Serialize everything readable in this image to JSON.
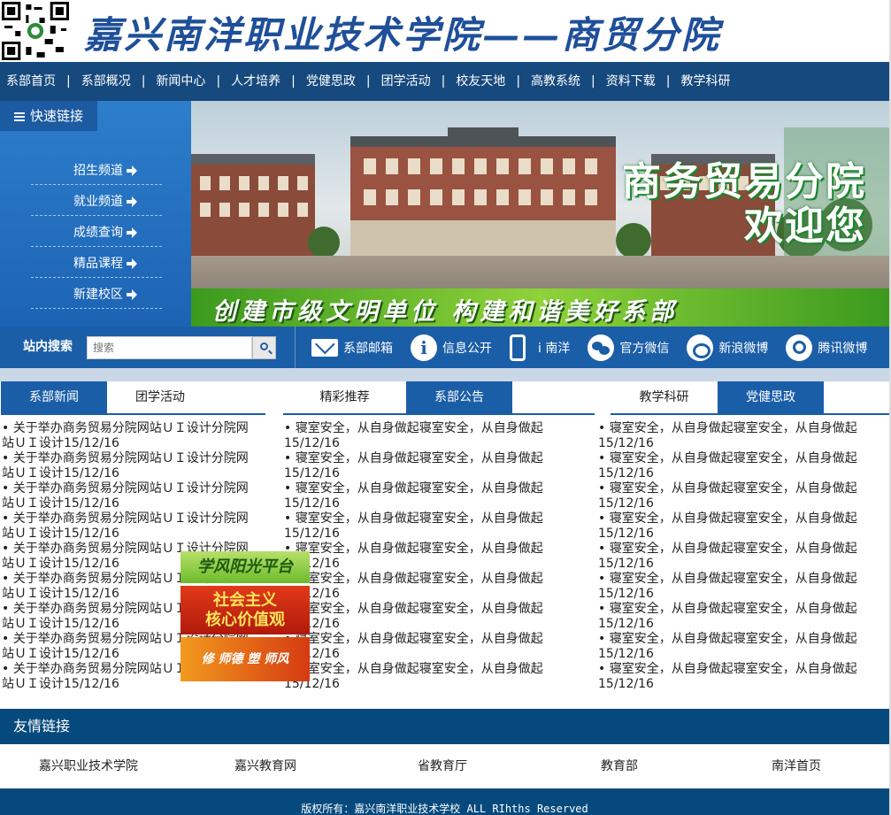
{
  "header": {
    "title": "嘉兴南洋职业技术学院——商贸分院"
  },
  "nav": {
    "items": [
      "系部首页",
      "系部概况",
      "新闻中心",
      "人才培养",
      "党健思政",
      "团学活动",
      "校友天地",
      "高教系统",
      "资料下载",
      "教学科研"
    ],
    "separator": "|"
  },
  "sidebar": {
    "title": "快速链接",
    "items": [
      {
        "label": "招生频道"
      },
      {
        "label": "就业频道"
      },
      {
        "label": "成绩查询"
      },
      {
        "label": "精品课程"
      },
      {
        "label": "新建校区"
      }
    ]
  },
  "banner": {
    "line1": "商务贸易分院",
    "line2": "欢迎您",
    "slogan": "创建市级文明单位 构建和谐美好系部"
  },
  "search": {
    "label": "站内搜索",
    "placeholder": "搜索"
  },
  "social": {
    "items": [
      {
        "label": "系部邮箱"
      },
      {
        "label": "信息公开"
      },
      {
        "label": "i 南洋"
      },
      {
        "label": "官方微信"
      },
      {
        "label": "新浪微博"
      },
      {
        "label": "腾讯微博"
      }
    ],
    "info_glyph": "i"
  },
  "tabs": {
    "group1": [
      "系部新闻",
      "团学活动"
    ],
    "group2": [
      "精彩推荐",
      "系部公告"
    ],
    "group3": [
      "教学科研",
      "党健思政"
    ]
  },
  "columns": {
    "bullet": "•",
    "news": [
      {
        "text": " 关于举办商务贸易分院网站ＵＩ设计分院网站ＵＩ设计",
        "date": "15/12/16"
      },
      {
        "text": " 关于举办商务贸易分院网站ＵＩ设计分院网站ＵＩ设计",
        "date": "15/12/16"
      },
      {
        "text": " 关于举办商务贸易分院网站ＵＩ设计分院网站ＵＩ设计",
        "date": "15/12/16"
      },
      {
        "text": " 关于举办商务贸易分院网站ＵＩ设计分院网站ＵＩ设计",
        "date": "15/12/16"
      },
      {
        "text": " 关于举办商务贸易分院网站ＵＩ设计分院网站ＵＩ设计",
        "date": "15/12/16"
      },
      {
        "text": " 关于举办商务贸易分院网站ＵＩ设计分院网站ＵＩ设计",
        "date": "15/12/16"
      },
      {
        "text": " 关于举办商务贸易分院网站ＵＩ设计分院网站ＵＩ设计",
        "date": "15/12/16"
      },
      {
        "text": " 关于举办商务贸易分院网站ＵＩ设计分院网站ＵＩ设计",
        "date": "15/12/16"
      },
      {
        "text": " 关于举办商务贸易分院网站ＵＩ设计分院网站ＵＩ设计",
        "date": "15/12/16"
      }
    ],
    "recommend": [
      {
        "text": " 寝室安全，从自身做起寝室安全，从自身做起",
        "date": "15/12/16"
      },
      {
        "text": " 寝室安全，从自身做起寝室安全，从自身做起",
        "date": "15/12/16"
      },
      {
        "text": " 寝室安全，从自身做起寝室安全，从自身做起",
        "date": "15/12/16"
      },
      {
        "text": " 寝室安全，从自身做起寝室安全，从自身做起",
        "date": "15/12/16"
      },
      {
        "text": " 寝室安全，从自身做起寝室安全，从自身做起",
        "date": "15/12/16"
      },
      {
        "text": " 寝室安全，从自身做起寝室安全，从自身做起",
        "date": "15/12/16"
      },
      {
        "text": " 寝室安全，从自身做起寝室安全，从自身做起",
        "date": "15/12/16"
      },
      {
        "text": " 寝室安全，从自身做起寝室安全，从自身做起",
        "date": "15/12/16"
      },
      {
        "text": " 寝室安全，从自身做起寝室安全，从自身做起",
        "date": "15/12/16"
      }
    ],
    "teaching": [
      {
        "text": " 寝室安全，从自身做起寝室安全，从自身做起",
        "date": "15/12/16"
      },
      {
        "text": " 寝室安全，从自身做起寝室安全，从自身做起",
        "date": "15/12/16"
      },
      {
        "text": " 寝室安全，从自身做起寝室安全，从自身做起",
        "date": "15/12/16"
      },
      {
        "text": " 寝室安全，从自身做起寝室安全，从自身做起",
        "date": "15/12/16"
      },
      {
        "text": " 寝室安全，从自身做起寝室安全，从自身做起",
        "date": "15/12/16"
      },
      {
        "text": " 寝室安全，从自身做起寝室安全，从自身做起",
        "date": "15/12/16"
      },
      {
        "text": " 寝室安全，从自身做起寝室安全，从自身做起",
        "date": "15/12/16"
      },
      {
        "text": " 寝室安全，从自身做起寝室安全，从自身做起",
        "date": "15/12/16"
      },
      {
        "text": " 寝室安全，从自身做起寝室安全，从自身做起",
        "date": "15/12/16"
      }
    ]
  },
  "badges": {
    "b1": "学风阳光平台",
    "b2_line1": "社会主义",
    "b2_line2": "核心价值观",
    "b3": "修 师德 塑 师风"
  },
  "friends": {
    "title": "友情链接",
    "items": [
      "嘉兴职业技术学院",
      "嘉兴教育网",
      "省教育厅",
      "教育部",
      "南洋首页"
    ]
  },
  "footer": {
    "text": "版权所有：嘉兴南洋职业技术学校 ALL RIhths Reserved"
  },
  "colors": {
    "nav_bg": "#16497e",
    "accent": "#1b5ea8",
    "footer_bg": "#064a7d"
  }
}
